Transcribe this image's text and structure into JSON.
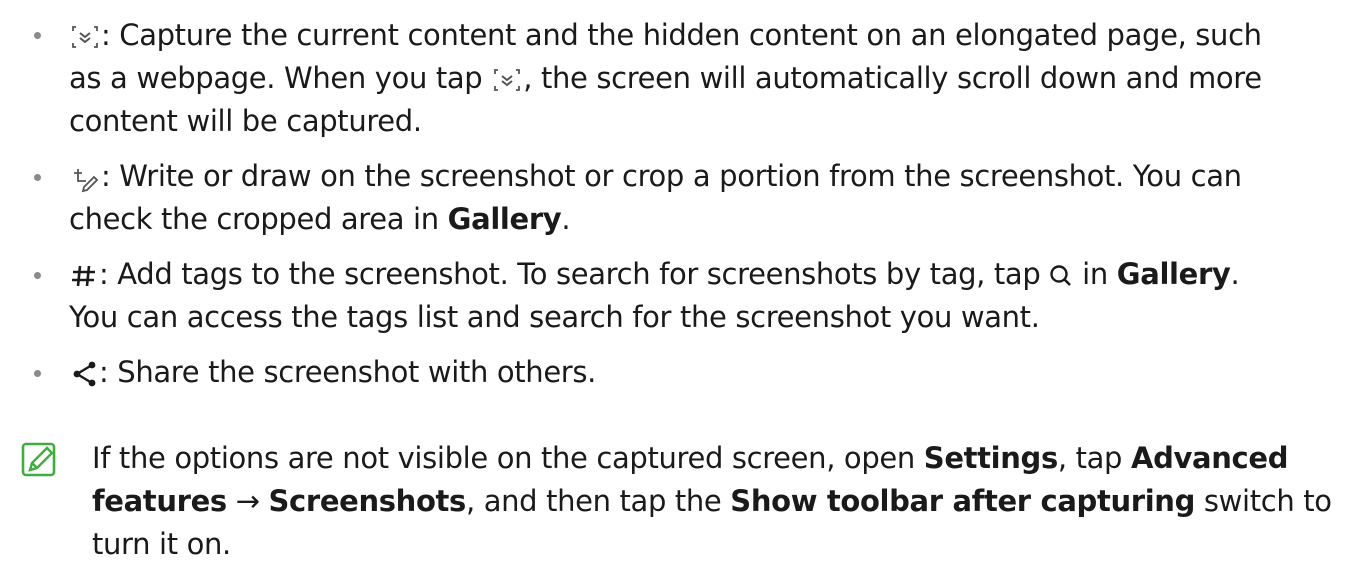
{
  "bullets": [
    {
      "icon": "scroll-capture-icon",
      "lines": [
        [
          ": Capture the current content and the hidden content on an elongated page, such"
        ],
        [
          "as a webpage. When you tap ",
          ", the screen will automatically scroll down and more"
        ],
        [
          "content will be captured."
        ]
      ]
    },
    {
      "icon": "draw-crop-icon",
      "lines": [
        [
          ": Write or draw on the screenshot or crop a portion from the screenshot. You can"
        ],
        [
          "check the cropped area in ",
          "Gallery",
          "."
        ]
      ]
    },
    {
      "icon": "hashtag-icon",
      "lines": [
        [
          ": Add tags to the screenshot. To search for screenshots by tag, tap ",
          " in ",
          "Gallery",
          "."
        ],
        [
          "You can access the tags list and search for the screenshot you want."
        ]
      ]
    },
    {
      "icon": "share-icon",
      "lines": [
        [
          ": Share the screenshot with others."
        ]
      ]
    }
  ],
  "note": {
    "icon": "note-icon",
    "lines": [
      [
        "If the options are not visible on the captured screen, open ",
        "Settings",
        ", tap ",
        "Advanced"
      ],
      [
        "features",
        " → ",
        "Screenshots",
        ", and then tap the ",
        "Show toolbar after capturing",
        " switch to"
      ],
      [
        "turn it on."
      ]
    ]
  },
  "colors": {
    "text": "#1a1a1a",
    "bullet": "#8a8a8a",
    "note_icon": "#3fae3f"
  }
}
